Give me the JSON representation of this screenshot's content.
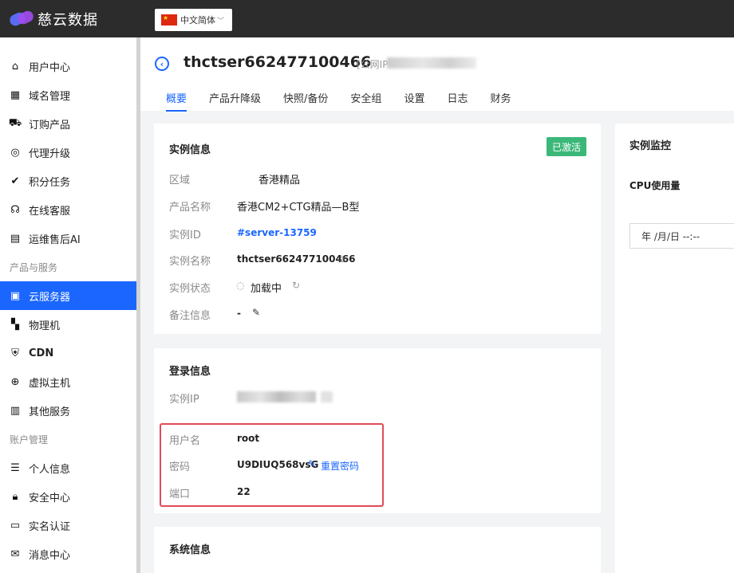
{
  "brand": {
    "name": "慈云数据"
  },
  "language": {
    "label": "中文简体"
  },
  "sidebar": {
    "items": [
      {
        "id": "user-center",
        "label": "用户中心",
        "icon": "home-icon"
      },
      {
        "id": "domain",
        "label": "域名管理",
        "icon": "grid-icon"
      },
      {
        "id": "order",
        "label": "订购产品",
        "icon": "cart-icon"
      },
      {
        "id": "agent",
        "label": "代理升级",
        "icon": "fingerprint-icon"
      },
      {
        "id": "points",
        "label": "积分任务",
        "icon": "check-circle-icon"
      },
      {
        "id": "support",
        "label": "在线客服",
        "icon": "headset-icon"
      },
      {
        "id": "ai",
        "label": "运维售后AI",
        "icon": "doc-icon"
      }
    ],
    "group_products": "产品与服务",
    "product_items": [
      {
        "id": "cloud",
        "label": "云服务器",
        "icon": "apps-icon",
        "active": true
      },
      {
        "id": "physical",
        "label": "物理机",
        "icon": "qr-icon"
      },
      {
        "id": "cdn",
        "label": "CDN",
        "icon": "shield-icon"
      },
      {
        "id": "vhost",
        "label": "虚拟主机",
        "icon": "globe-icon"
      },
      {
        "id": "other",
        "label": "其他服务",
        "icon": "book-icon"
      }
    ],
    "group_account": "账户管理",
    "account_items": [
      {
        "id": "profile",
        "label": "个人信息",
        "icon": "id-card-icon"
      },
      {
        "id": "security",
        "label": "安全中心",
        "icon": "lock-icon"
      },
      {
        "id": "realname",
        "label": "实名认证",
        "icon": "card-icon"
      },
      {
        "id": "messages",
        "label": "消息中心",
        "icon": "mail-icon"
      }
    ]
  },
  "header": {
    "title": "thctser662477100466",
    "ip_prefix": "[公网IP",
    "tabs": [
      "概要",
      "产品升降级",
      "快照/备份",
      "安全组",
      "设置",
      "日志",
      "财务"
    ],
    "active_tab": "概要"
  },
  "instance_info": {
    "title": "实例信息",
    "status_badge": "已激活",
    "rows": [
      {
        "label": "区域",
        "value": "香港精品"
      },
      {
        "label": "产品名称",
        "value": "香港CM2+CTG精品—B型"
      },
      {
        "label": "实例ID",
        "value": "#server-13759"
      },
      {
        "label": "实例名称",
        "value": "thctser662477100466"
      },
      {
        "label": "实例状态",
        "value": "加载中"
      },
      {
        "label": "备注信息",
        "value": "-"
      }
    ]
  },
  "login_info": {
    "title": "登录信息",
    "ip_label": "实例IP",
    "username_label": "用户名",
    "username": "root",
    "password_label": "密码",
    "password": "U9DIUQ568vsG",
    "reset_password": "重置密码",
    "port_label": "端口",
    "port": "22"
  },
  "system_info": {
    "title": "系统信息"
  },
  "monitor": {
    "title": "实例监控",
    "cpu_label": "CPU使用量",
    "date_placeholder": "年 /月/日 --:--"
  },
  "colors": {
    "accent": "#1a66ff",
    "success": "#3bb879",
    "highlight": "#e34a5a"
  }
}
